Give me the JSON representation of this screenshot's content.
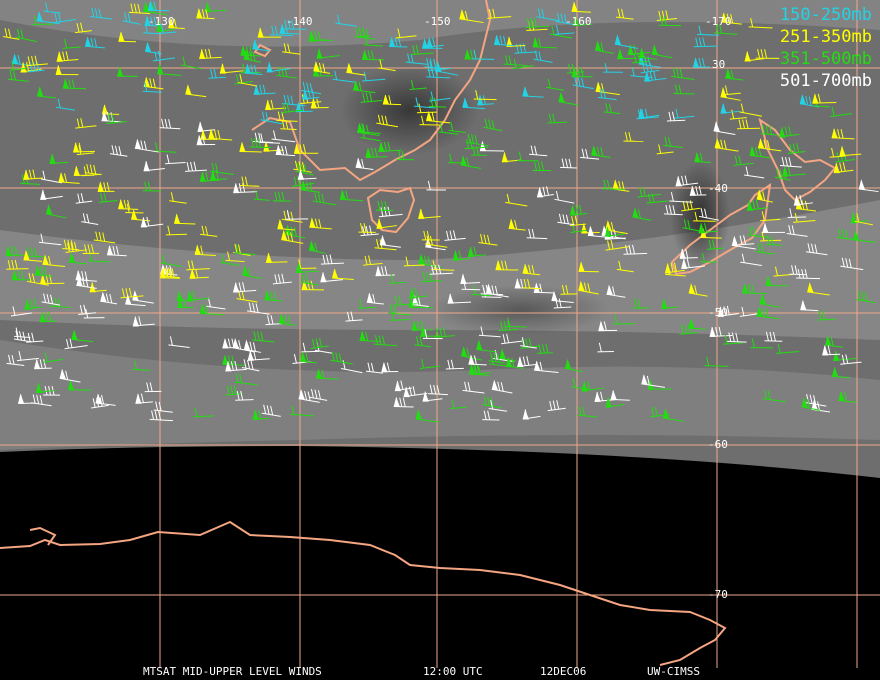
{
  "map": {
    "lon_labels": [
      "-130",
      "-140",
      "-150",
      "-160",
      "-170"
    ],
    "lat_labels": [
      "30",
      "-40",
      "-50",
      "-60",
      "-70"
    ],
    "legend": [
      {
        "label": "150-250mb",
        "color": "#22d3e6"
      },
      {
        "label": "251-350mb",
        "color": "#ffff00"
      },
      {
        "label": "351-500mb",
        "color": "#22dd11"
      },
      {
        "label": "501-700mb",
        "color": "#ffffff"
      }
    ],
    "footer": {
      "product": "MTSAT MID-UPPER LEVEL WINDS",
      "time": "12:00 UTC",
      "date": "12DEC06",
      "source": "UW-CIMSS"
    },
    "colors": {
      "gridline": "#f0a888",
      "coastline": "#f4a582",
      "space": "#000000"
    }
  }
}
